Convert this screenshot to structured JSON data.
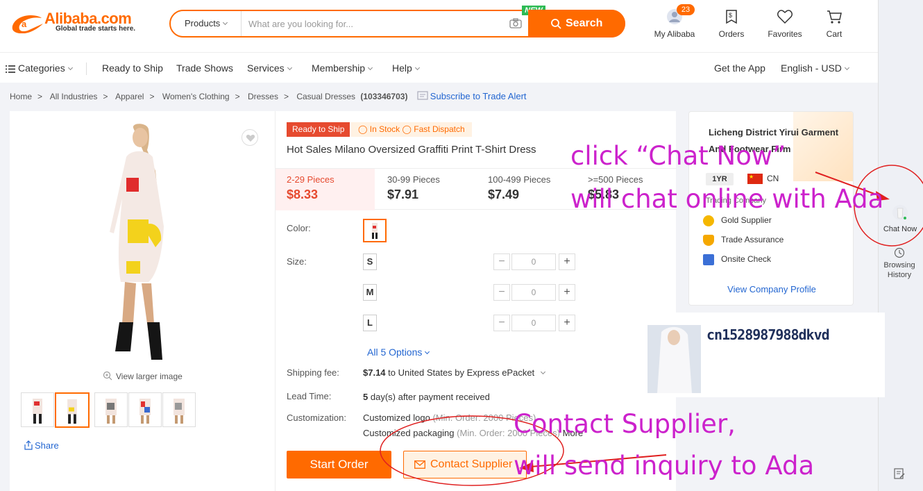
{
  "header": {
    "logo_text": "Alibaba.com",
    "logo_tagline": "Global trade starts here.",
    "search_category": "Products",
    "search_placeholder": "What are you looking for...",
    "new_badge": "NEW",
    "search_button": "Search",
    "icons": [
      {
        "label": "My Alibaba",
        "icon": "user-avatar-icon",
        "badge": "23"
      },
      {
        "label": "Orders",
        "icon": "orders-icon"
      },
      {
        "label": "Favorites",
        "icon": "heart-icon"
      },
      {
        "label": "Cart",
        "icon": "cart-icon"
      }
    ]
  },
  "nav": {
    "categories": "Categories",
    "items": [
      "Ready to Ship",
      "Trade Shows",
      "Services",
      "Membership",
      "Help"
    ],
    "get_app": "Get the App",
    "language": "English - USD"
  },
  "breadcrumb": {
    "items": [
      "Home",
      "All Industries",
      "Apparel",
      "Women's Clothing",
      "Dresses",
      "Casual Dresses"
    ],
    "count": "(103346703)",
    "subscribe": "Subscribe to Trade Alert"
  },
  "gallery": {
    "view_larger": "View larger image",
    "share": "Share",
    "thumbnail_count": 5,
    "active_thumbnail": 2
  },
  "product": {
    "tag_ready": "Ready to Ship",
    "tag_stock": "In Stock",
    "tag_dispatch": "Fast Dispatch",
    "title": "Hot Sales Milano Oversized Graffiti Print T-Shirt Dress",
    "tiers": [
      {
        "qty": "2-29 Pieces",
        "price": "$8.33"
      },
      {
        "qty": "30-99 Pieces",
        "price": "$7.91"
      },
      {
        "qty": "100-499 Pieces",
        "price": "$7.49"
      },
      {
        "qty": ">=500 Pieces",
        "price": "$5.83"
      }
    ],
    "color_label": "Color:",
    "size_label": "Size:",
    "sizes": [
      {
        "size": "S",
        "qty": "0"
      },
      {
        "size": "M",
        "qty": "0"
      },
      {
        "size": "L",
        "qty": "0"
      }
    ],
    "all_options": "All 5 Options",
    "shipping_label": "Shipping fee:",
    "shipping_price": "$7.14",
    "shipping_text": "to United States by Express ePacket",
    "lead_label": "Lead Time:",
    "lead_days": "5",
    "lead_text": "day(s) after payment received",
    "custom_label": "Customization:",
    "custom_logo": "Customized logo",
    "custom_logo_note": "(Min. Order: 2000 Pieces)",
    "custom_pack": "Customized packaging",
    "custom_pack_note": "(Min. Order: 2000 Pieces)",
    "custom_more": "More",
    "start_order": "Start Order",
    "contact_supplier": "Contact Supplier"
  },
  "supplier": {
    "name": "Licheng District Yirui Garment And Footwear Firm",
    "years": "1YR",
    "country": "CN",
    "type": "Trading Company",
    "badges": [
      "Gold Supplier",
      "Trade Assurance",
      "Onsite Check"
    ],
    "view_profile": "View Company Profile"
  },
  "rightbar": {
    "chat_now": "Chat Now",
    "history": "Browsing History"
  },
  "overlay_user": {
    "id": "cn1528987988dkvd"
  },
  "annotations": {
    "chat_line1": "click   “Chat Now”",
    "chat_line2": "will chat online with Ada",
    "contact_line1": "Contact Supplier,",
    "contact_line2": "will send inquiry to Ada"
  },
  "colors": {
    "brand_orange": "#ff6a00",
    "link_blue": "#2366d1",
    "annotation_magenta": "#cc22cc",
    "annotation_red": "#e02020"
  }
}
